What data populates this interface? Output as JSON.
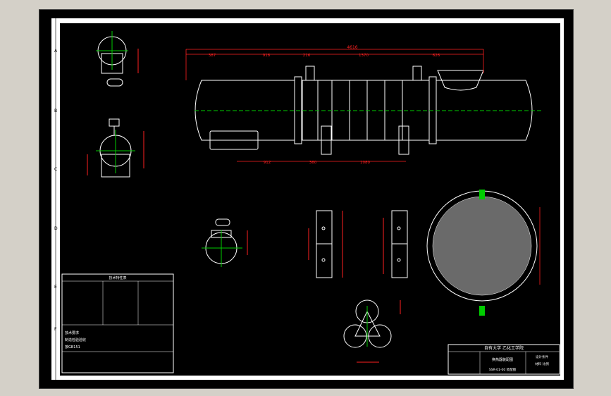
{
  "view": {
    "background_color": "#000000",
    "outer_background_color": "#d4d0c8",
    "line_color": "#ffffff",
    "dimension_color": "#ff2020",
    "centerline_color": "#00cc00"
  },
  "border": {
    "row_zones": [
      "A",
      "B",
      "C",
      "D",
      "E",
      "F"
    ]
  },
  "main_view": {
    "overall_length": "4616",
    "top_segments": [
      "387",
      "918",
      "216",
      "1370",
      "626"
    ],
    "bottom_segments": [
      "912",
      "360",
      "1080"
    ]
  },
  "title_block": {
    "title": "自有大学 乙化工学院",
    "drawing_name": "换热器装配图",
    "right_note_1": "设计条件",
    "right_note_2": "材料 比例",
    "drawing_number": "SSR-01-00 装配图"
  },
  "tech_table": {
    "header": "技术特性表",
    "notes": [
      "技术要求",
      "制造检验验收",
      "按GB151"
    ]
  }
}
